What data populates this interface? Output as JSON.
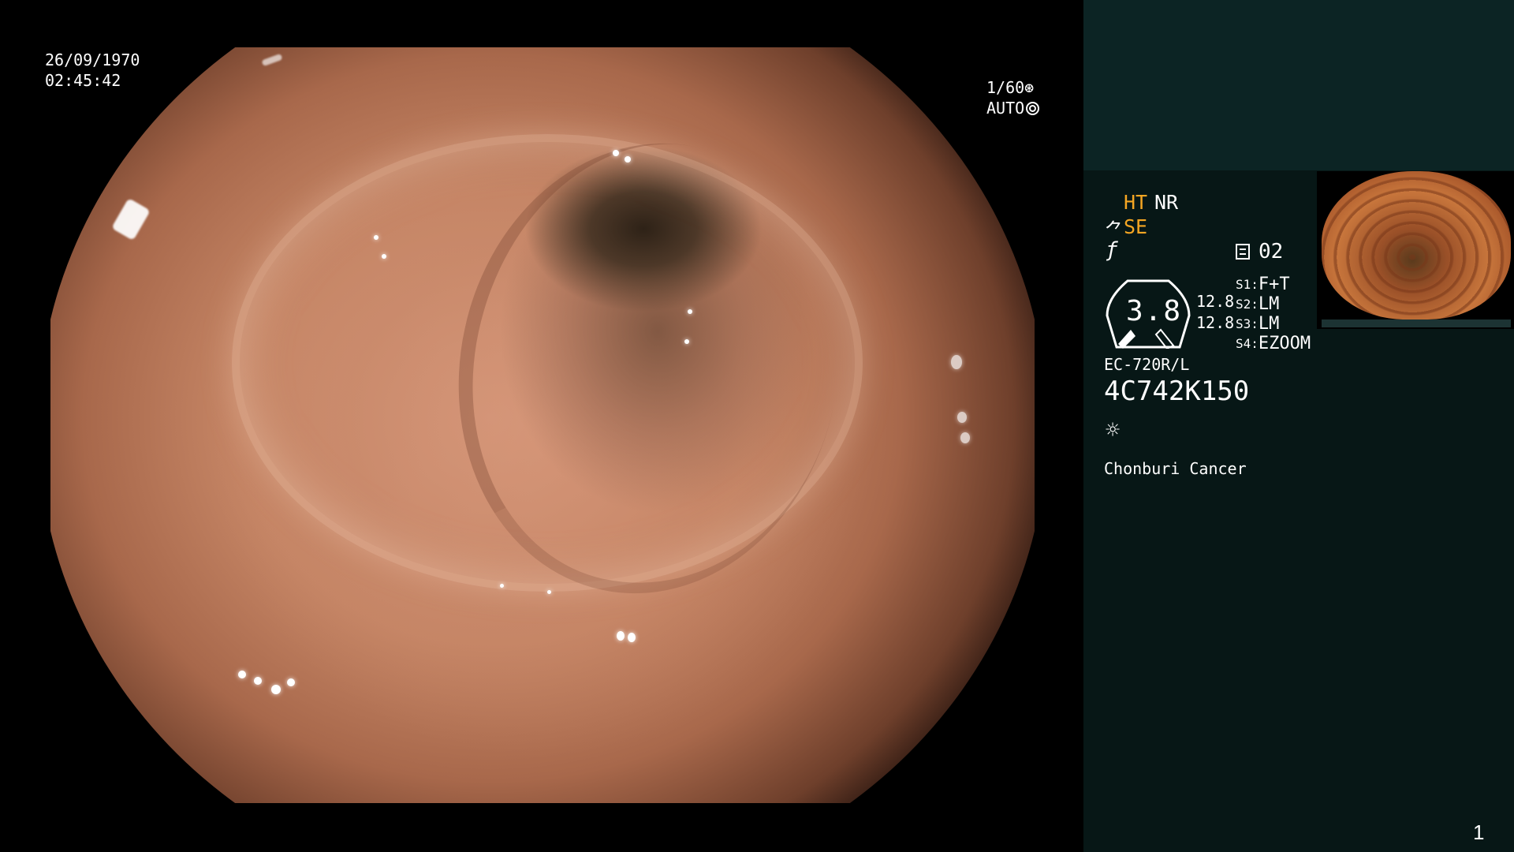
{
  "overlay": {
    "date": "26/09/1970",
    "time": "02:45:42",
    "shutter": "1/60",
    "iris": "AUTO"
  },
  "panel": {
    "ht": "HT",
    "nr": "NR",
    "se": "SE",
    "memory": "02",
    "gauge_value": "3.8",
    "gauge_side_1": "12.8",
    "gauge_side_2": "12.8",
    "slots": [
      {
        "key": "S1",
        "value": "F+T"
      },
      {
        "key": "S2",
        "value": "LM"
      },
      {
        "key": "S3",
        "value": "LM"
      },
      {
        "key": "S4",
        "value": "EZOOM"
      }
    ],
    "scope_model": "EC-720R/L",
    "serial": "4C742K150",
    "hospital": "Chonburi Cancer",
    "page_number": "1"
  },
  "icons": {
    "shutter": "aperture-icon",
    "iris": "iris-ring-icon",
    "se": "structure-enhance-icon",
    "enhance": "enhance-curve-icon",
    "memory": "memory-card-icon",
    "light": "light-sun-icon"
  },
  "colors": {
    "background": "#000000",
    "panel": "#071716",
    "panel_top": "#0c2424",
    "accent": "#f5a623"
  }
}
